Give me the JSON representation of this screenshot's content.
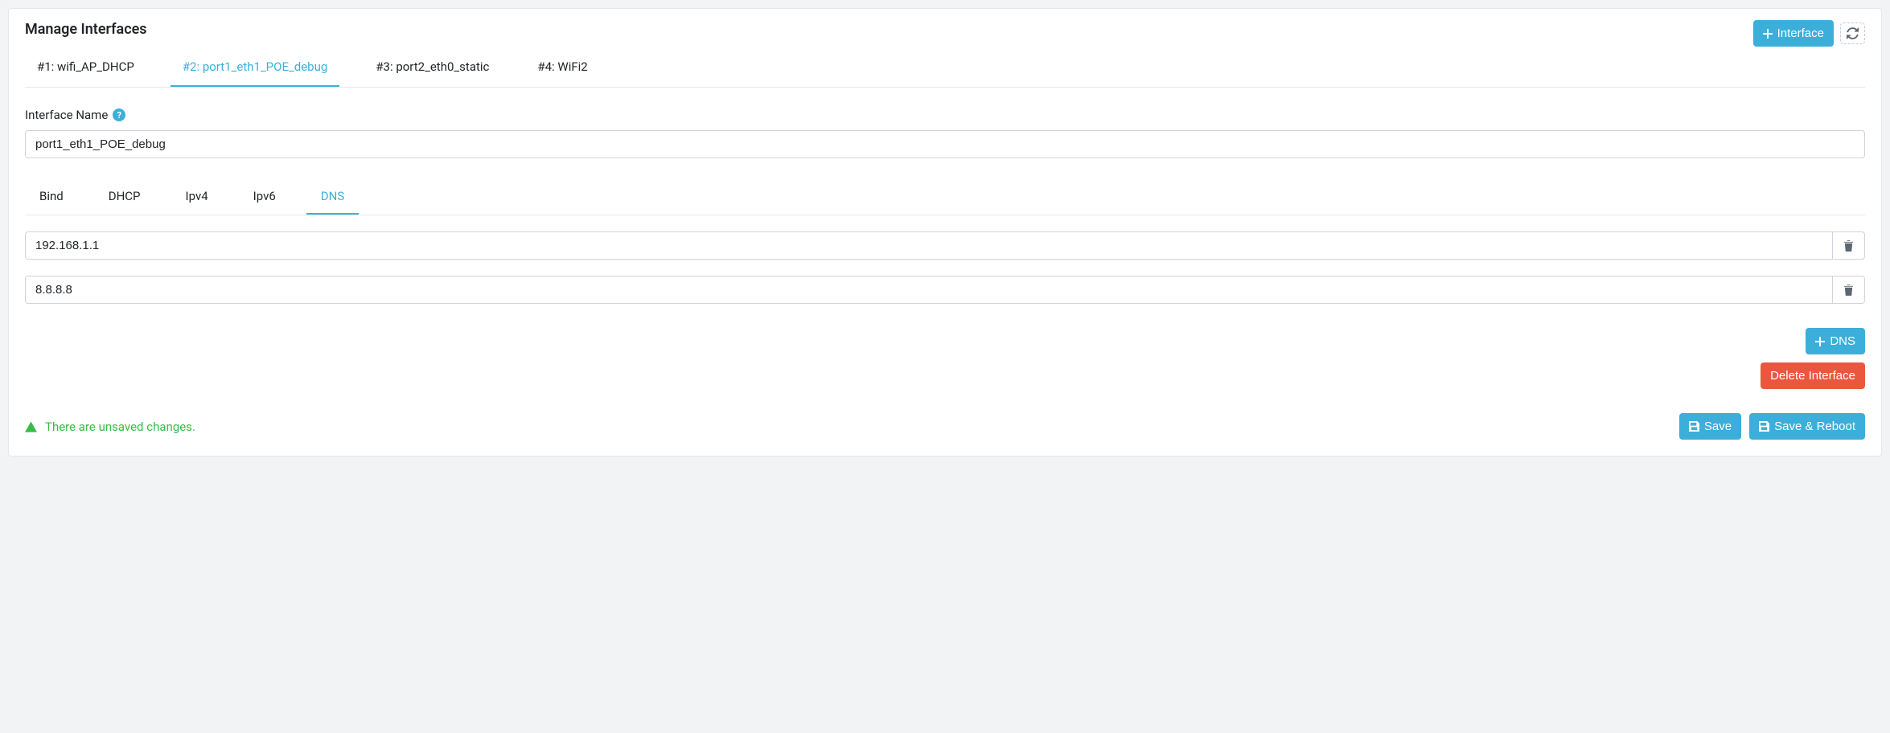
{
  "header": {
    "title": "Manage Interfaces",
    "add_label": "Interface"
  },
  "tabs": [
    {
      "label": "#1: wifi_AP_DHCP",
      "active": false
    },
    {
      "label": "#2: port1_eth1_POE_debug",
      "active": true
    },
    {
      "label": "#3: port2_eth0_static",
      "active": false
    },
    {
      "label": "#4: WiFi2",
      "active": false
    }
  ],
  "form": {
    "name_label": "Interface Name",
    "name_value": "port1_eth1_POE_debug"
  },
  "subtabs": [
    {
      "label": "Bind",
      "active": false
    },
    {
      "label": "DHCP",
      "active": false
    },
    {
      "label": "Ipv4",
      "active": false
    },
    {
      "label": "Ipv6",
      "active": false
    },
    {
      "label": "DNS",
      "active": true
    }
  ],
  "dns": [
    {
      "value": "192.168.1.1"
    },
    {
      "value": "8.8.8.8"
    }
  ],
  "buttons": {
    "add_dns": "DNS",
    "delete_iface": "Delete Interface",
    "save": "Save",
    "save_reboot": "Save & Reboot"
  },
  "status": {
    "unsaved": "There are unsaved changes."
  }
}
